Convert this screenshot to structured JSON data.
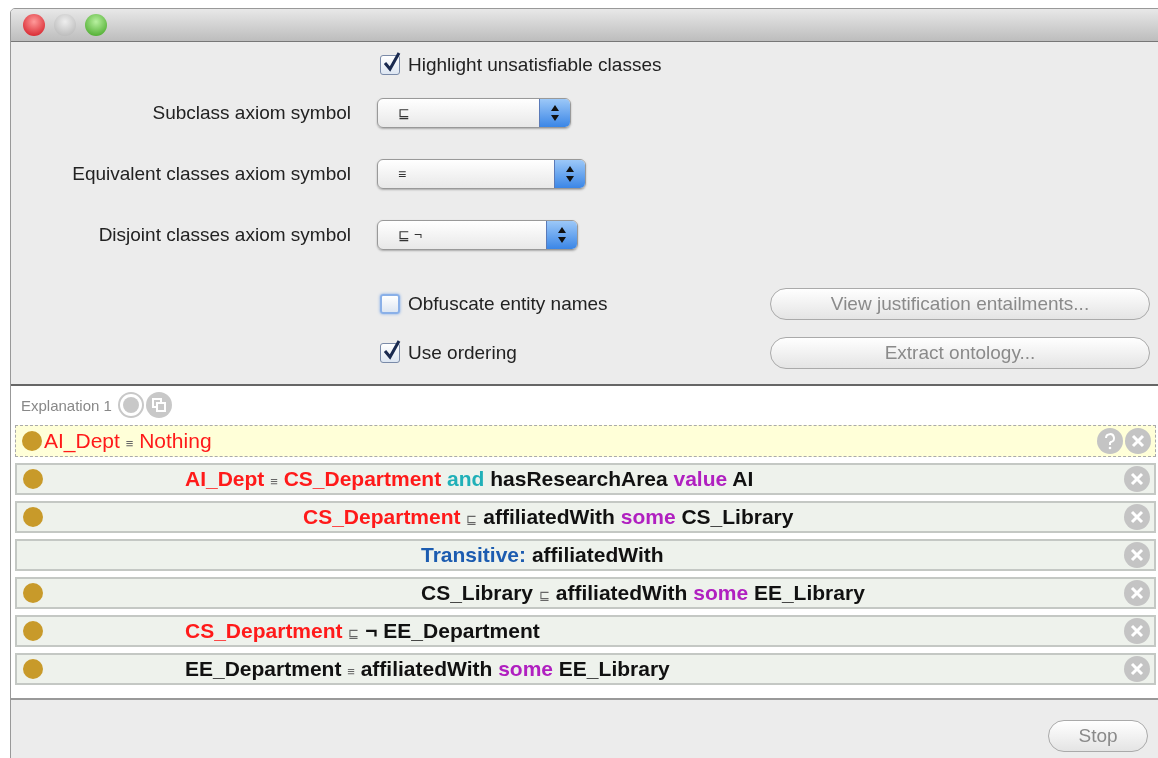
{
  "options": {
    "highlight": {
      "label": "Highlight unsatisfiable classes",
      "checked": true
    },
    "symbols": [
      {
        "label": "Subclass axiom symbol",
        "value": "⊑"
      },
      {
        "label": "Equivalent classes axiom symbol",
        "value": "≡"
      },
      {
        "label": "Disjoint classes axiom symbol",
        "value": "⊑ ¬"
      }
    ],
    "obfuscate": {
      "label": "Obfuscate entity names",
      "checked": false
    },
    "ordering": {
      "label": "Use ordering",
      "checked": true
    },
    "buttons": [
      {
        "label": "View justification entailments...",
        "disabled": true
      },
      {
        "label": "Extract ontology...",
        "disabled": true
      }
    ]
  },
  "explanation": {
    "title": "Explanation 1",
    "entailment": {
      "marked": true,
      "tokens": [
        {
          "text": "AI_Dept",
          "kind": "class"
        },
        {
          "text": "≡",
          "kind": "symbol"
        },
        {
          "text": "Nothing",
          "kind": "class"
        }
      ]
    },
    "axioms": [
      {
        "marked": true,
        "tokens": [
          {
            "text": "AI_Dept",
            "kind": "class"
          },
          {
            "text": "≡",
            "kind": "symbol"
          },
          {
            "text": "CS_Department",
            "kind": "class"
          },
          {
            "text": "and",
            "kind": "connective"
          },
          {
            "text": "hasResearchArea",
            "kind": "plain"
          },
          {
            "text": "value",
            "kind": "restriction"
          },
          {
            "text": "AI",
            "kind": "plain"
          }
        ],
        "children": [
          {
            "marked": true,
            "tokens": [
              {
                "text": "CS_Department",
                "kind": "class"
              },
              {
                "text": "⊑",
                "kind": "symbol"
              },
              {
                "text": "affiliatedWith",
                "kind": "plain"
              },
              {
                "text": "some",
                "kind": "restriction"
              },
              {
                "text": "CS_Library",
                "kind": "plain"
              }
            ],
            "children": [
              {
                "marked": false,
                "tokens": [
                  {
                    "text": "Transitive:",
                    "kind": "characteristic"
                  },
                  {
                    "text": "affiliatedWith",
                    "kind": "plain"
                  }
                ]
              },
              {
                "marked": true,
                "tokens": [
                  {
                    "text": "CS_Library",
                    "kind": "plain"
                  },
                  {
                    "text": "⊑",
                    "kind": "symbol"
                  },
                  {
                    "text": "affiliatedWith",
                    "kind": "plain"
                  },
                  {
                    "text": "some",
                    "kind": "restriction"
                  },
                  {
                    "text": "EE_Library",
                    "kind": "plain"
                  }
                ]
              }
            ]
          }
        ]
      },
      {
        "marked": true,
        "tokens": [
          {
            "text": "CS_Department",
            "kind": "class"
          },
          {
            "text": "⊑",
            "kind": "symbol"
          },
          {
            "text": "¬",
            "kind": "plain"
          },
          {
            "text": "EE_Department",
            "kind": "plain"
          }
        ]
      },
      {
        "marked": true,
        "tokens": [
          {
            "text": "EE_Department",
            "kind": "plain"
          },
          {
            "text": "≡",
            "kind": "symbol"
          },
          {
            "text": "affiliatedWith",
            "kind": "plain"
          },
          {
            "text": "some",
            "kind": "restriction"
          },
          {
            "text": "EE_Library",
            "kind": "plain"
          }
        ]
      }
    ]
  },
  "stop_button": {
    "label": "Stop",
    "disabled": true
  }
}
